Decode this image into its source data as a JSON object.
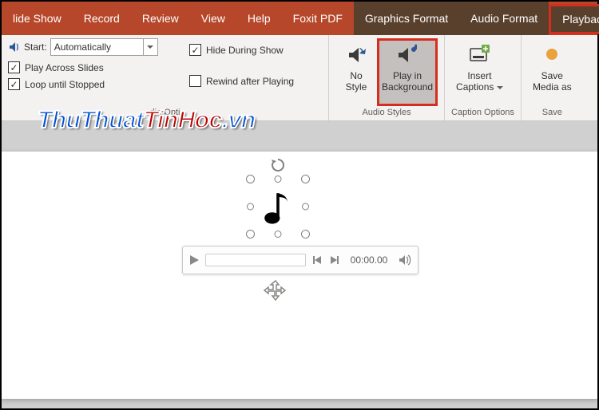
{
  "tabs": {
    "slide_show": "lide Show",
    "record": "Record",
    "review": "Review",
    "view": "View",
    "help": "Help",
    "foxit": "Foxit PDF",
    "graphics": "Graphics Format",
    "audio": "Audio Format",
    "playback": "Playback"
  },
  "ribbon": {
    "start_label": "Start:",
    "start_value": "Automatically",
    "play_across": "Play Across Slides",
    "loop": "Loop until Stopped",
    "hide": "Hide During Show",
    "rewind": "Rewind after Playing",
    "audio_options_group": "dio Opti",
    "no_style": "No\nStyle",
    "play_bg": "Play in\nBackground",
    "audio_styles_group": "Audio Styles",
    "insert_captions": "Insert\nCaptions",
    "caption_options_group": "Caption Options",
    "save_media": "Save\nMedia as",
    "save_group": "Save"
  },
  "player": {
    "time": "00:00.00"
  },
  "watermark": {
    "a": "ThuThuat",
    "b": "TinHoc",
    "c": ".vn"
  }
}
